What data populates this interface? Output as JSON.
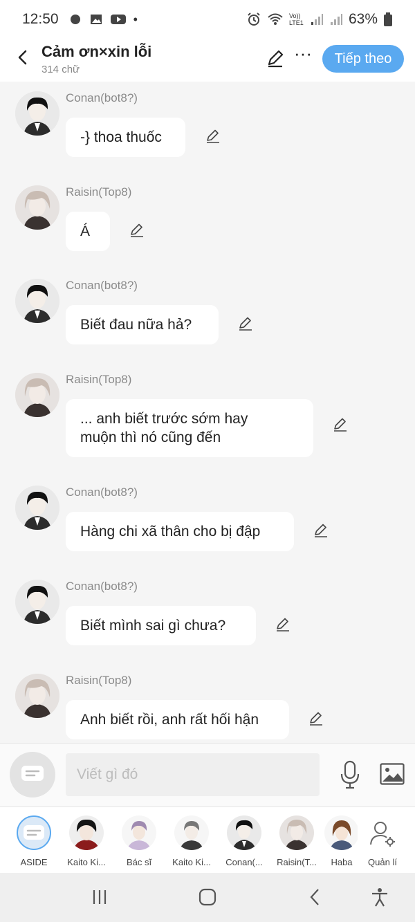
{
  "status_bar": {
    "time": "12:50",
    "network": "Vo)) LTE1",
    "battery": "63%"
  },
  "header": {
    "title": "Cảm ơn×xin lỗi",
    "subtitle": "314 chữ",
    "next_button": "Tiếp theo"
  },
  "messages": [
    {
      "sender": "Conan(bot8?)",
      "text": "-} thoa thuốc",
      "avatar": "dark-hair-character"
    },
    {
      "sender": "Raisin(Top8)",
      "text": "Á",
      "avatar": "light-hair-character"
    },
    {
      "sender": "Conan(bot8?)",
      "text": "Biết đau nữa hả?",
      "avatar": "dark-hair-character"
    },
    {
      "sender": "Raisin(Top8)",
      "text": "... anh biết trước sớm hay\nmuộn thì nó cũng đến",
      "avatar": "light-hair-character"
    },
    {
      "sender": "Conan(bot8?)",
      "text": "Hàng chi xã thân cho bị đập",
      "avatar": "dark-hair-character"
    },
    {
      "sender": "Conan(bot8?)",
      "text": "Biết mình sai gì chưa?",
      "avatar": "dark-hair-character"
    },
    {
      "sender": "Raisin(Top8)",
      "text": "Anh biết rồi, anh rất hối hận",
      "avatar": "light-hair-character"
    }
  ],
  "composer": {
    "placeholder": "Viết gì đó"
  },
  "characters": [
    {
      "label": "ASIDE"
    },
    {
      "label": "Kaito Ki..."
    },
    {
      "label": "Bác sĩ"
    },
    {
      "label": "Kaito Ki..."
    },
    {
      "label": "Conan(..."
    },
    {
      "label": "Raisin(T..."
    },
    {
      "label": "Haba"
    },
    {
      "label": "Quản lí"
    }
  ],
  "colors": {
    "accent": "#5aa9f0",
    "background": "#f5f5f5",
    "bubble": "#ffffff",
    "sender_text": "#8a8a8a"
  }
}
